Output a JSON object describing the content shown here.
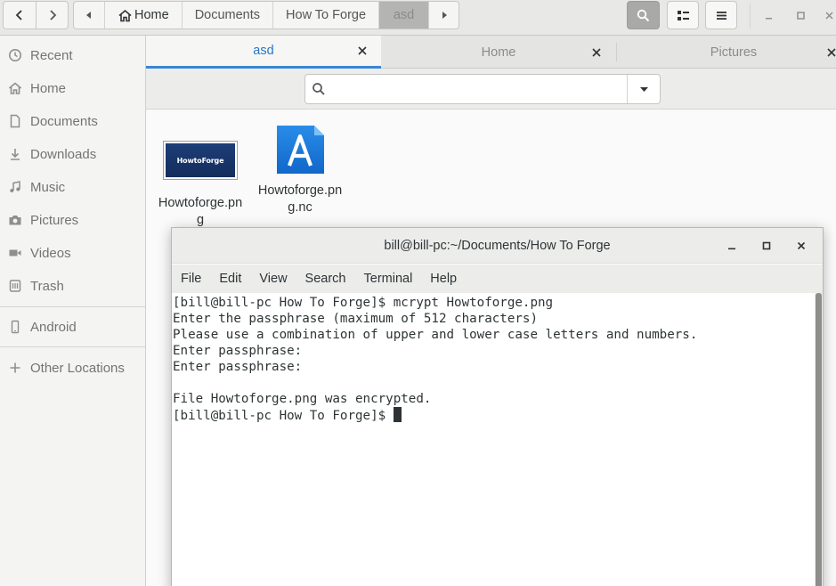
{
  "header": {
    "breadcrumbs": [
      "Home",
      "Documents",
      "How To Forge",
      "asd"
    ]
  },
  "sidebar": {
    "items": [
      {
        "label": "Recent",
        "icon": "clock-icon"
      },
      {
        "label": "Home",
        "icon": "home-icon"
      },
      {
        "label": "Documents",
        "icon": "document-icon"
      },
      {
        "label": "Downloads",
        "icon": "download-icon"
      },
      {
        "label": "Music",
        "icon": "music-icon"
      },
      {
        "label": "Pictures",
        "icon": "camera-icon"
      },
      {
        "label": "Videos",
        "icon": "video-icon"
      },
      {
        "label": "Trash",
        "icon": "trash-icon"
      }
    ],
    "devices": [
      {
        "label": "Android",
        "icon": "phone-icon"
      }
    ],
    "other": {
      "label": "Other Locations",
      "icon": "plus-icon"
    }
  },
  "tabs": [
    {
      "label": "asd",
      "active": true
    },
    {
      "label": "Home",
      "active": false
    },
    {
      "label": "Pictures",
      "active": false
    }
  ],
  "search": {
    "value": "",
    "placeholder": ""
  },
  "files": [
    {
      "name": "Howtoforge.png",
      "thumb_text": "HowtoForge"
    },
    {
      "name": "Howtoforge.png.nc",
      "icon": "file-a-icon"
    }
  ],
  "terminal": {
    "title": "bill@bill-pc:~/Documents/How To Forge",
    "menu": [
      "File",
      "Edit",
      "View",
      "Search",
      "Terminal",
      "Help"
    ],
    "lines": [
      "[bill@bill-pc How To Forge]$ mcrypt Howtoforge.png",
      "Enter the passphrase (maximum of 512 characters)",
      "Please use a combination of upper and lower case letters and numbers.",
      "Enter passphrase:",
      "Enter passphrase:",
      "",
      "File Howtoforge.png was encrypted.",
      "[bill@bill-pc How To Forge]$ "
    ]
  },
  "colors": {
    "accent": "#3a85d4",
    "terminal_bg": "#ffffff",
    "sidebar_text": "#737573"
  }
}
